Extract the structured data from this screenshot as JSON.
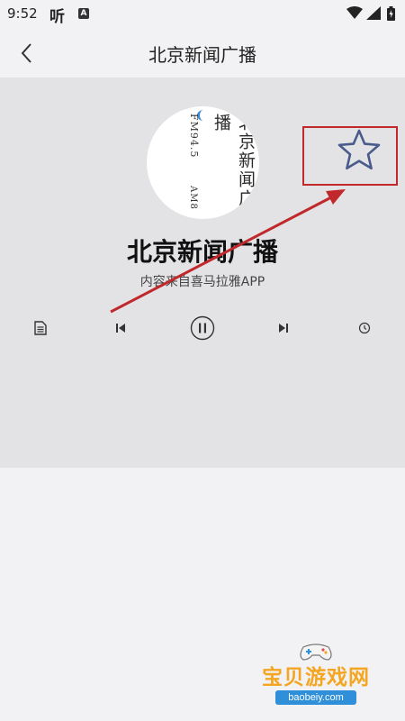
{
  "status_bar": {
    "time": "9:52",
    "app_glyph": "听",
    "badge_letter": "A"
  },
  "nav": {
    "title": "北京新闻广播"
  },
  "station": {
    "name": "北京新闻广播",
    "source": "内容来自喜马拉雅APP",
    "cover_logo": {
      "chinese": "北京新闻广播",
      "frequency": "FM94.5",
      "am": "AM8"
    }
  },
  "controls": [
    "playlist-icon",
    "previous-icon",
    "pause-icon",
    "next-icon",
    "timer-icon"
  ],
  "watermark": {
    "text": "宝贝游戏网",
    "url": "baobeiy.com"
  },
  "colors": {
    "annotation_red": "#c0282b",
    "star_outline": "#4a5a8a"
  }
}
